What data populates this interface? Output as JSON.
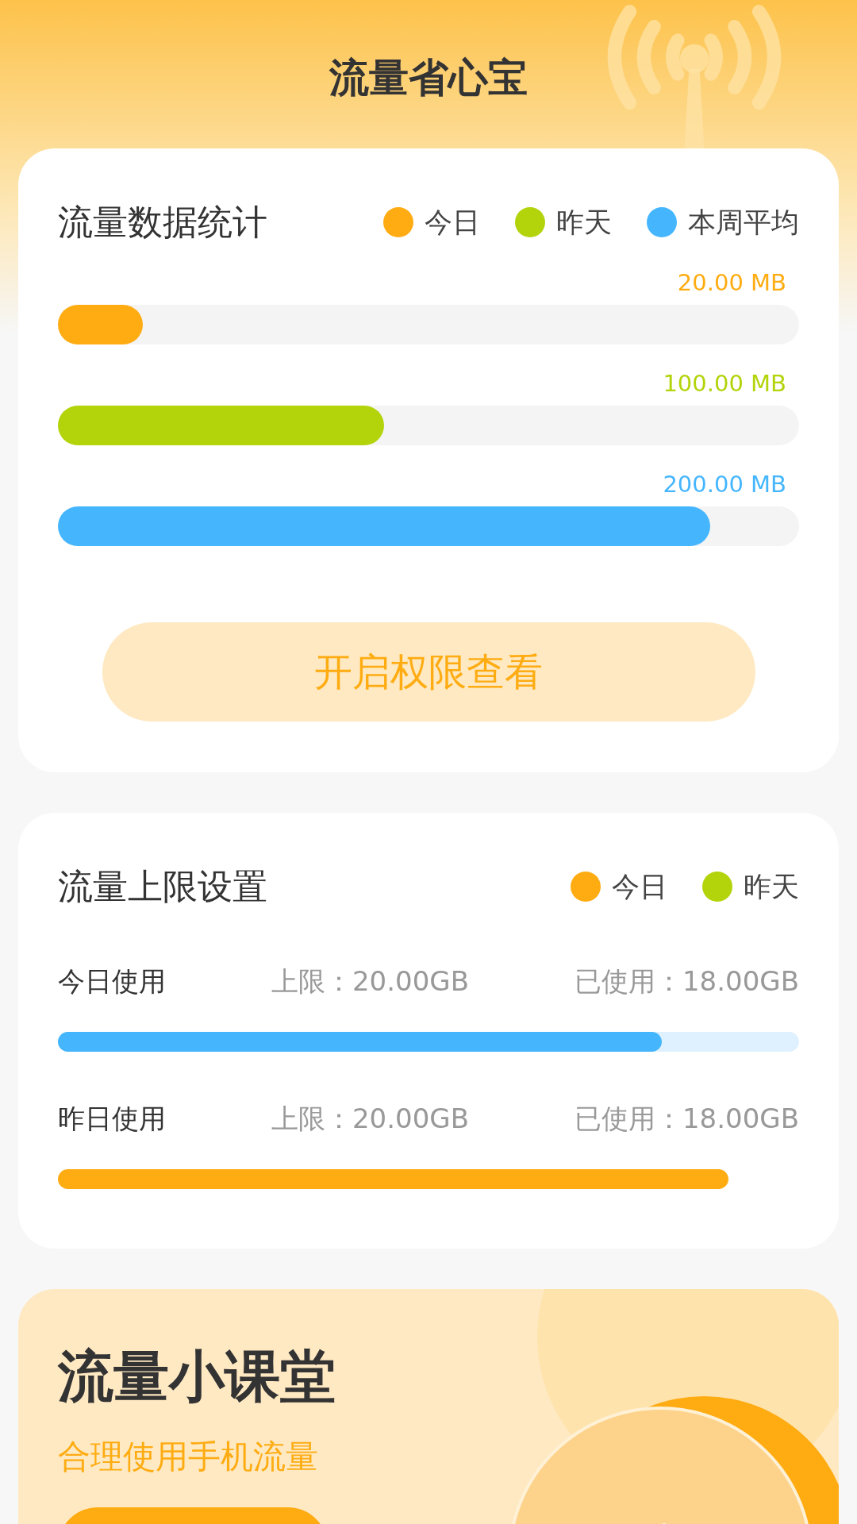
{
  "header": {
    "title": "流量省心宝"
  },
  "stats": {
    "title": "流量数据统计",
    "legend": [
      {
        "label": "今日",
        "color": "#ffac12"
      },
      {
        "label": "昨天",
        "color": "#b3d30a"
      },
      {
        "label": "本周平均",
        "color": "#45b6fe"
      }
    ],
    "bars": [
      {
        "reading": "20.00 MB",
        "level": 0.115,
        "color": "#ffac12"
      },
      {
        "reading": "100.00 MB",
        "level": 0.44,
        "color": "#b3d30a"
      },
      {
        "reading": "200.00 MB",
        "level": 0.88,
        "color": "#45b6fe"
      }
    ],
    "button": "开启权限查看"
  },
  "limits": {
    "title": "流量上限设置",
    "legend": [
      {
        "label": "今日",
        "color": "#ffac12"
      },
      {
        "label": "昨天",
        "color": "#b3d30a"
      }
    ],
    "rows": [
      {
        "name": "今日使用",
        "limit": "上限：20.00GB",
        "used": "已使用：18.00GB",
        "level": 0.815,
        "color": "#45b6fe",
        "track_visible": true
      },
      {
        "name": "昨日使用",
        "limit": "上限：20.00GB",
        "used": "已使用：18.00GB",
        "level": 0.905,
        "color": "#ffac12",
        "track_visible": false
      }
    ]
  },
  "lesson": {
    "title": "流量小课堂",
    "subtitle": "合理使用手机流量"
  }
}
